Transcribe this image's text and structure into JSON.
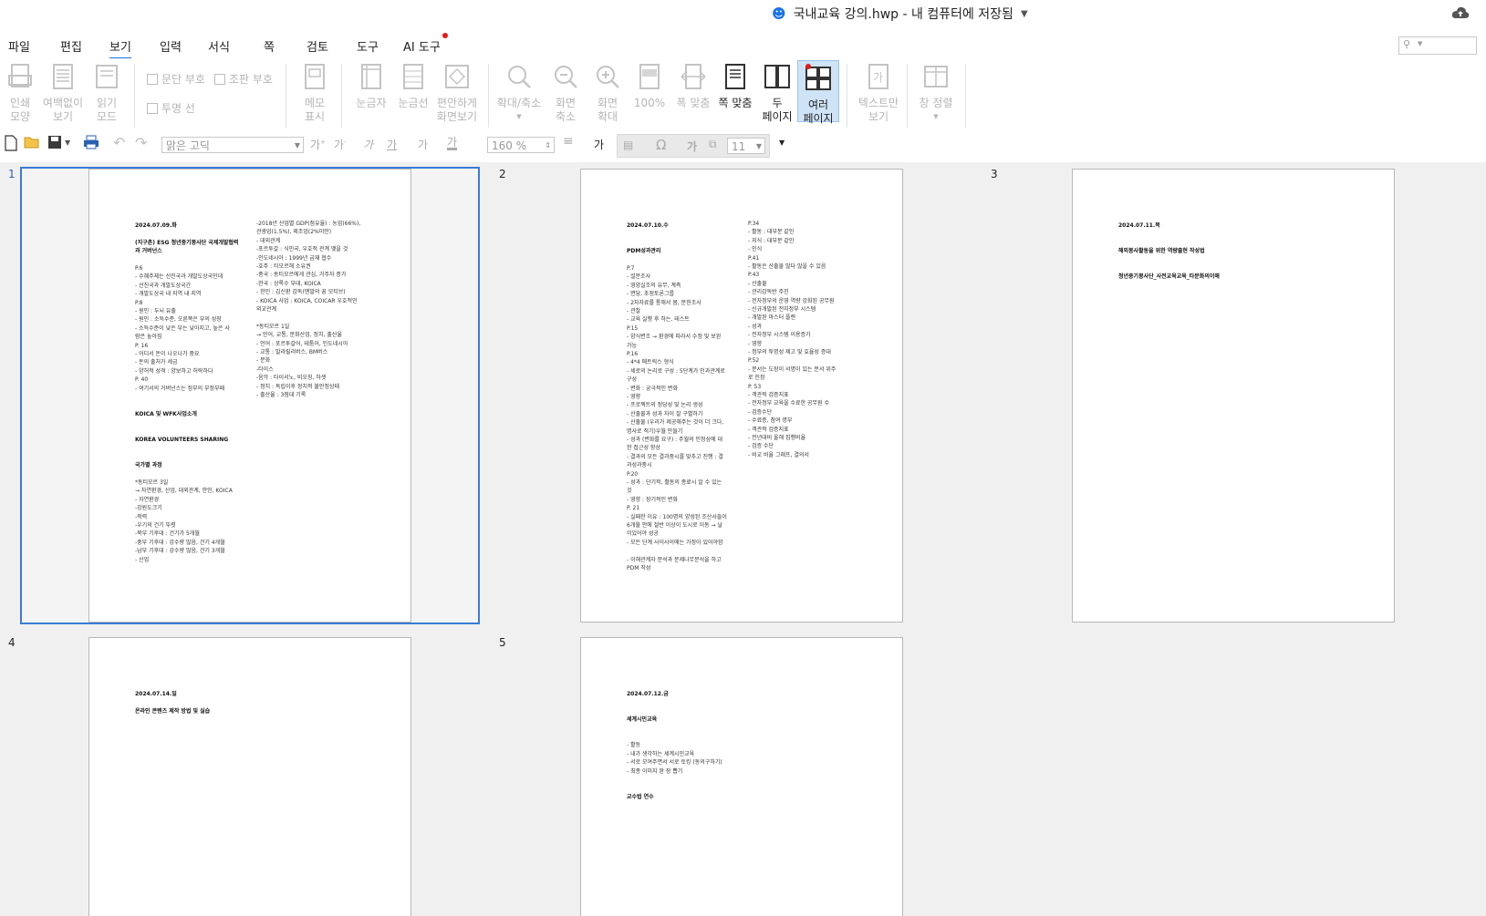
{
  "window": {
    "title": "국내교육 강의.hwp - 내 컴퓨터에 저장됨"
  },
  "menu": {
    "items": [
      "파일",
      "편집",
      "보기",
      "입력",
      "서식",
      "쪽",
      "검토",
      "도구",
      "AI 도구"
    ],
    "active": "보기"
  },
  "ribbon": {
    "print_layout": "인쇄\n모양",
    "no_margin": "여백없이\n보기",
    "reading_mode": "읽기\n모드",
    "para_mark": "문단 부호",
    "layout_mark": "조판 부호",
    "transparent_line": "투명 선",
    "memo_show": "메모\n표시",
    "ruler": "눈금자",
    "grid": "눈금선",
    "comfortable": "편안하게\n화면보기",
    "zoom": "확대/축소",
    "zoom_out": "화면\n축소",
    "zoom_in": "화면\n확대",
    "percent100": "100%",
    "fit_width": "폭 맞춤",
    "fit_page": "쪽 맞춤",
    "two_pages": "두\n페이지",
    "multi_pages": "여러\n페이지",
    "text_only": "텍스트만\n보기",
    "arrange": "창 정렬"
  },
  "toolbar": {
    "font": "맑은 고딕",
    "zoom": "160 %",
    "size": "11",
    "bold_glyph": "가"
  },
  "pages": [
    {
      "number": "1",
      "left": [
        {
          "t": "2024.07.09.화",
          "b": true
        },
        {
          "t": "",
          "b": false
        },
        {
          "t": "(지구촌) ESG 청년중기봉사단 국제개발협력",
          "b": true
        },
        {
          "t": "과 거버넌스",
          "b": true
        },
        {
          "t": "",
          "b": false
        },
        {
          "t": "P.6",
          "b": false
        },
        {
          "t": "- 수혜주체는 선진국과 개발도상국인데",
          "b": false
        },
        {
          "t": "- 선진국과 개발도상국간",
          "b": false
        },
        {
          "t": "- 개발도상국 내 지역 내 지역",
          "b": false
        },
        {
          "t": "P.8",
          "b": false
        },
        {
          "t": "- 원인 : 두뇌 유출",
          "b": false
        },
        {
          "t": "- 원인 : 소득수준, 오른쪽은 부의 성장",
          "b": false
        },
        {
          "t": "- 소득수준이 낮은 부는 낮아지고, 높은 사",
          "b": false
        },
        {
          "t": "람은 높아짐",
          "b": false
        },
        {
          "t": "P. 16",
          "b": false
        },
        {
          "t": "- 어디서 돈이 나오나가 중요",
          "b": false
        },
        {
          "t": "- 돈의 출처가 세금",
          "b": false
        },
        {
          "t": "- 양허적 성격 : 양보하고 허락하다",
          "b": false
        },
        {
          "t": "P. 40",
          "b": false
        },
        {
          "t": "- 여기서의 거버넌스는 정부의 부정부패",
          "b": false
        },
        {
          "t": "",
          "b": false
        },
        {
          "t": "",
          "b": false
        },
        {
          "t": "KOICA 및 WFK사업소개",
          "b": true
        },
        {
          "t": "",
          "b": false
        },
        {
          "t": "",
          "b": false
        },
        {
          "t": "KOREA VOLUNTEERS SHARING",
          "b": true
        },
        {
          "t": "",
          "b": false
        },
        {
          "t": "",
          "b": false
        },
        {
          "t": "국가별 과정",
          "b": true
        },
        {
          "t": "",
          "b": false
        },
        {
          "t": "*동티모르 3일",
          "b": false
        },
        {
          "t": "→ 자연환경, 산업, 대외관계, 한인, KOICA",
          "b": false
        },
        {
          "t": "- 자연환경",
          "b": false
        },
        {
          "t": "-강원도크기",
          "b": false
        },
        {
          "t": "-적력",
          "b": false
        },
        {
          "t": "-우기의 건기 뚜렷",
          "b": false
        },
        {
          "t": "-북부 기후대 : 건기가 5개월",
          "b": false
        },
        {
          "t": "-중부 기후대 : 강수량 많음, 건기 4개월",
          "b": false
        },
        {
          "t": "-남부 기후대 : 강수량 많음, 건기 3개월",
          "b": false
        },
        {
          "t": "- 산업",
          "b": false
        }
      ],
      "right": [
        {
          "t": "-2018년 산업별 GDP(점유율) : 농업(66%),",
          "b": false
        },
        {
          "t": "관광업(1.5%), 제조업(2%미만)",
          "b": false
        },
        {
          "t": "- 대외관계",
          "b": false
        },
        {
          "t": "-포르투갈 : 식민국, 우호적 관계 맺을 것",
          "b": false
        },
        {
          "t": "-인도네시아 : 1999년 급재 협수",
          "b": false
        },
        {
          "t": "-호주 : 티모르해 소유권",
          "b": false
        },
        {
          "t": "-중국 : 동티모르에게 관심, 거주자 증가",
          "b": false
        },
        {
          "t": "-한국 : 상록수 부대, KOICA",
          "b": false
        },
        {
          "t": "- 한인 : 김신환 감독(맨발의 꿈 모티브)",
          "b": false
        },
        {
          "t": "- KOICA 사업 : KOICA, COICAR 우호적인",
          "b": false
        },
        {
          "t": "외교관계",
          "b": false
        },
        {
          "t": "",
          "b": false
        },
        {
          "t": "*동티모르 1일",
          "b": false
        },
        {
          "t": "→ 언어, 교통, 문화산업, 정치, 출산율",
          "b": false
        },
        {
          "t": "- 언어 : 포르투갈어, 테툼어, 인도네시아",
          "b": false
        },
        {
          "t": "- 교통 : 말라릴리버스, BM버스",
          "b": false
        },
        {
          "t": "- 문화",
          "b": false
        },
        {
          "t": "-타이스",
          "b": false
        },
        {
          "t": "-음악 : 타이서노, 비오칭, 하셋",
          "b": false
        },
        {
          "t": "- 정치 : 독립이후 정치적 불안정상태",
          "b": false
        },
        {
          "t": "- 출산율 : 3점대 기록",
          "b": false
        }
      ]
    },
    {
      "number": "2",
      "left": [
        {
          "t": "2024.07.10.수",
          "b": true
        },
        {
          "t": "",
          "b": false
        },
        {
          "t": "",
          "b": false
        },
        {
          "t": "PDM성과관리",
          "b": true
        },
        {
          "t": "",
          "b": false
        },
        {
          "t": "P.7",
          "b": false
        },
        {
          "t": "- 설문조사",
          "b": false
        },
        {
          "t": "- 영양실조의 유무, 계측",
          "b": false
        },
        {
          "t": "- 면담, 초점토론그룹",
          "b": false
        },
        {
          "t": "- 2차자료를 통해서 봄, 문헌조사",
          "b": false
        },
        {
          "t": "- 관찰",
          "b": false
        },
        {
          "t": "- 교육 실행 후 하는, 테스트",
          "b": false
        },
        {
          "t": "P.15",
          "b": false
        },
        {
          "t": "- 양식변조 → 환경에 따라서 수정 및 보완",
          "b": false
        },
        {
          "t": "가능",
          "b": false
        },
        {
          "t": "P.16",
          "b": false
        },
        {
          "t": "- 4*4 매트릭스 형식",
          "b": false
        },
        {
          "t": "- 세로의 논리로 구성 : 5단계가 인과관계로",
          "b": false
        },
        {
          "t": "구성",
          "b": false
        },
        {
          "t": "- 변화 : 궁극적인 변화",
          "b": false
        },
        {
          "t": "- 영향",
          "b": false
        },
        {
          "t": "- 프로젝트의 정당성 및 논리 생성",
          "b": false
        },
        {
          "t": "- 산출물과 성과 차이 잘 구별하기",
          "b": false
        },
        {
          "t": "- 산출물 (우리가 제공해주는 것이 더 크다,",
          "b": false
        },
        {
          "t": "명사로 적기)우월 만들기",
          "b": false
        },
        {
          "t": "- 성과 (변화를 요구) : 주월의 인정성에 대",
          "b": false
        },
        {
          "t": "한 접근성 향상",
          "b": false
        },
        {
          "t": "- 결과의 모든 결과중시를 맞추고 진행 : 결",
          "b": false
        },
        {
          "t": "과성과중시",
          "b": false
        },
        {
          "t": "P.20",
          "b": false
        },
        {
          "t": "- 성과 : 단기적, 활동의 종료시 알 수 있는",
          "b": false
        },
        {
          "t": "것",
          "b": false
        },
        {
          "t": "- 영향 : 장기적인 변화",
          "b": false
        },
        {
          "t": "P. 21",
          "b": false
        },
        {
          "t": "- 실패한 이유 : 100명의 양성된 조산사들이",
          "b": false
        },
        {
          "t": "6개월 안에 절반 이상이 도시로 이동 → 날",
          "b": false
        },
        {
          "t": "이있어야 성공",
          "b": false
        },
        {
          "t": "- 모든 단계 사이사이에는 가정이 있어야함",
          "b": false
        },
        {
          "t": "",
          "b": false
        },
        {
          "t": "- 이해관계자 분석과 문제나무분석을 하고",
          "b": false
        },
        {
          "t": "PDM 작성",
          "b": false
        }
      ],
      "right": [
        {
          "t": "P.34",
          "b": false
        },
        {
          "t": "- 활동 : 대부분 같인",
          "b": false
        },
        {
          "t": "- 지식 : 대부분 같인",
          "b": false
        },
        {
          "t": "- 인식",
          "b": false
        },
        {
          "t": "P.41",
          "b": false
        },
        {
          "t": "- 활동은 산출물 많다 많을 수 있음",
          "b": false
        },
        {
          "t": "P.43",
          "b": false
        },
        {
          "t": "- 산출물",
          "b": false
        },
        {
          "t": "- 관리감독반 주진",
          "b": false
        },
        {
          "t": "- 전자정부의 운영 역량 강화된 공무원",
          "b": false
        },
        {
          "t": "- 신규개발된 전자정부 시스템",
          "b": false
        },
        {
          "t": "- 개발된 마스터 플랜",
          "b": false
        },
        {
          "t": "- 성과",
          "b": false
        },
        {
          "t": "- 전자정부 시스템 이용증가",
          "b": false
        },
        {
          "t": "- 영향",
          "b": false
        },
        {
          "t": "- 정부의 투명성 제고 및 효율성 증대",
          "b": false
        },
        {
          "t": "P.52",
          "b": false
        },
        {
          "t": "- 문서는 도장이 서명이 있는 문서 위주",
          "b": false
        },
        {
          "t": "로 인정",
          "b": false
        },
        {
          "t": "P. 53",
          "b": false
        },
        {
          "t": "- 객관적 검증지표",
          "b": false
        },
        {
          "t": "- 전자정부 교육을 수료한 공무원 수",
          "b": false
        },
        {
          "t": "- 검증수단",
          "b": false
        },
        {
          "t": "- 수료증, 참여 명부",
          "b": false
        },
        {
          "t": "- 객관적 검증지표",
          "b": false
        },
        {
          "t": "- 전년대비 올해 집행비율",
          "b": false
        },
        {
          "t": "- 검증 수단",
          "b": false
        },
        {
          "t": "- 비교 비율 그래프, 결의서",
          "b": false
        }
      ]
    },
    {
      "number": "3",
      "left": [
        {
          "t": "2024.07.11.목",
          "b": true
        },
        {
          "t": "",
          "b": false
        },
        {
          "t": "",
          "b": false
        },
        {
          "t": "해외봉사활동을 위한 역량출현 작성법",
          "b": true
        },
        {
          "t": "",
          "b": false
        },
        {
          "t": "",
          "b": false
        },
        {
          "t": "청년중기봉사단_사전교육교육_타문화의이해",
          "b": true
        }
      ],
      "right": []
    },
    {
      "number": "4",
      "left": [
        {
          "t": "2024.07.14.일",
          "b": true
        },
        {
          "t": "",
          "b": false
        },
        {
          "t": "온라인 콘텐츠 제작 방법 및 실습",
          "b": true
        }
      ],
      "right": []
    },
    {
      "number": "5",
      "left": [
        {
          "t": "2024.07.12.금",
          "b": true
        },
        {
          "t": "",
          "b": false
        },
        {
          "t": "",
          "b": false
        },
        {
          "t": "세계시민교육",
          "b": true
        },
        {
          "t": "",
          "b": false
        },
        {
          "t": "",
          "b": false
        },
        {
          "t": "- 활동",
          "b": false
        },
        {
          "t": "- 내가 생각하는 세계시민교육",
          "b": false
        },
        {
          "t": "- 서로 모여주면서 서로 토킹 (동의구하기)",
          "b": false
        },
        {
          "t": "- 최종 이미지 완 장 뽑기",
          "b": false
        },
        {
          "t": "",
          "b": false
        },
        {
          "t": "",
          "b": false
        },
        {
          "t": "교수법 연수",
          "b": true
        }
      ],
      "right": []
    }
  ]
}
